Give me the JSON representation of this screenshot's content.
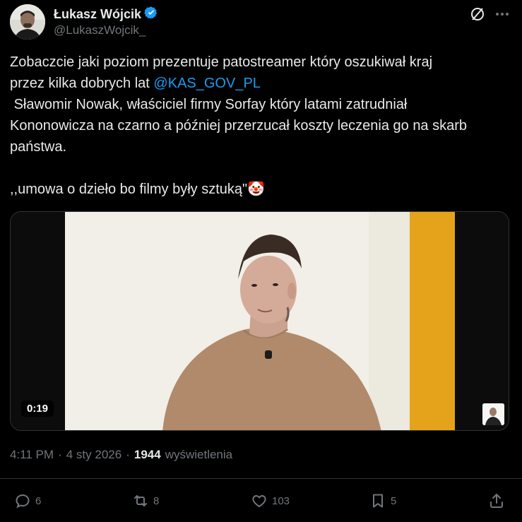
{
  "author": {
    "name": "Łukasz Wójcik",
    "handle": "@LukaszWojcik_",
    "verified": true,
    "avatar": "profile-photo"
  },
  "header_icons": [
    "grok-icon",
    "more-icon"
  ],
  "tweet": {
    "line1": "Zobaczcie jaki poziom prezentuje patostreamer który oszukiwał kraj",
    "line2_prefix": "przez kilka dobrych lat ",
    "mention": "@KAS_GOV_PL",
    "body": " Sławomir Nowak, właściciel firmy Sorfay który latami zatrudniał\nKononowicza na czarno a później przerzucał koszty leczenia go na skarb\npaństwa.",
    "quote": ",,umowa o dzieło bo filmy były sztuką\"",
    "emoji": "🤡"
  },
  "video": {
    "duration": "0:19",
    "accent_colors": {
      "wall": "#f0eee6",
      "yellow_panel": "#e7a51c",
      "sweater": "#b18a6b"
    }
  },
  "meta": {
    "time": "4:11 PM",
    "sep": "·",
    "date": "4 sty 2026",
    "views_count": "1944",
    "views_label": "wyświetlenia"
  },
  "actions": {
    "reply": "6",
    "retweet": "8",
    "like": "103",
    "bookmark": "5"
  },
  "colors": {
    "background": "#000000",
    "text": "#e7e9ea",
    "secondary": "#71767b",
    "link": "#1d9bf0",
    "verified": "#1d9bf0"
  }
}
